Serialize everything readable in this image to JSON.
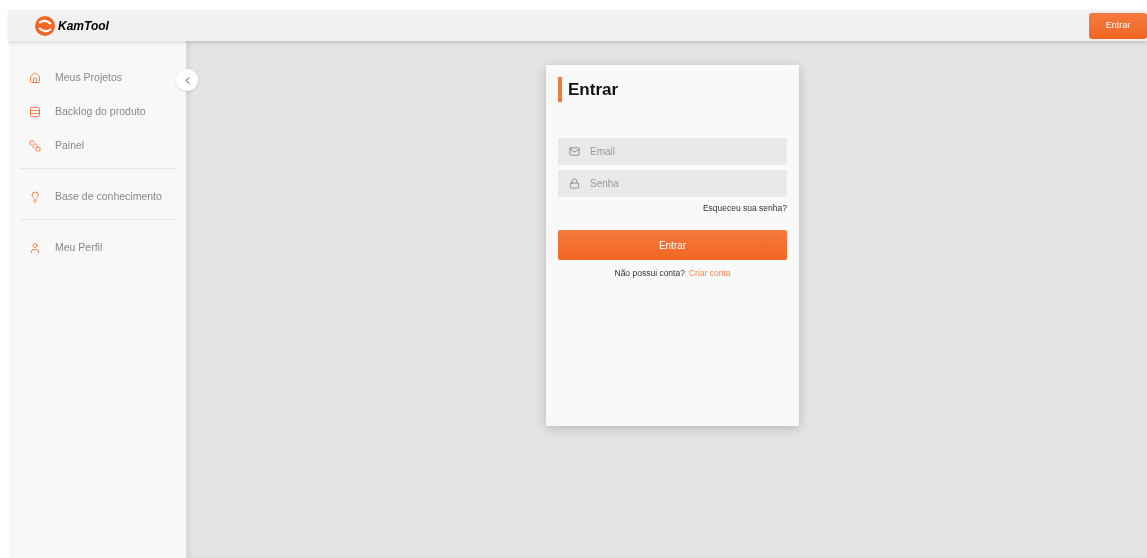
{
  "header": {
    "logo_text": "KamTool",
    "login_button": "Entrar"
  },
  "sidebar": {
    "groups": [
      {
        "items": [
          {
            "label": "Meus Projetos"
          },
          {
            "label": "Backlog do produto"
          },
          {
            "label": "Painel"
          }
        ]
      },
      {
        "items": [
          {
            "label": "Base de conhecimento"
          }
        ]
      },
      {
        "items": [
          {
            "label": "Meu Perfil"
          }
        ]
      }
    ]
  },
  "login_card": {
    "title": "Entrar",
    "email": {
      "placeholder": "Email"
    },
    "password": {
      "placeholder": "Senha"
    },
    "forgot_link": "Esqueceu sua senha?",
    "submit_button": "Entrar",
    "signup_prompt": "Não possui conta?",
    "signup_link": "Criar conta"
  }
}
